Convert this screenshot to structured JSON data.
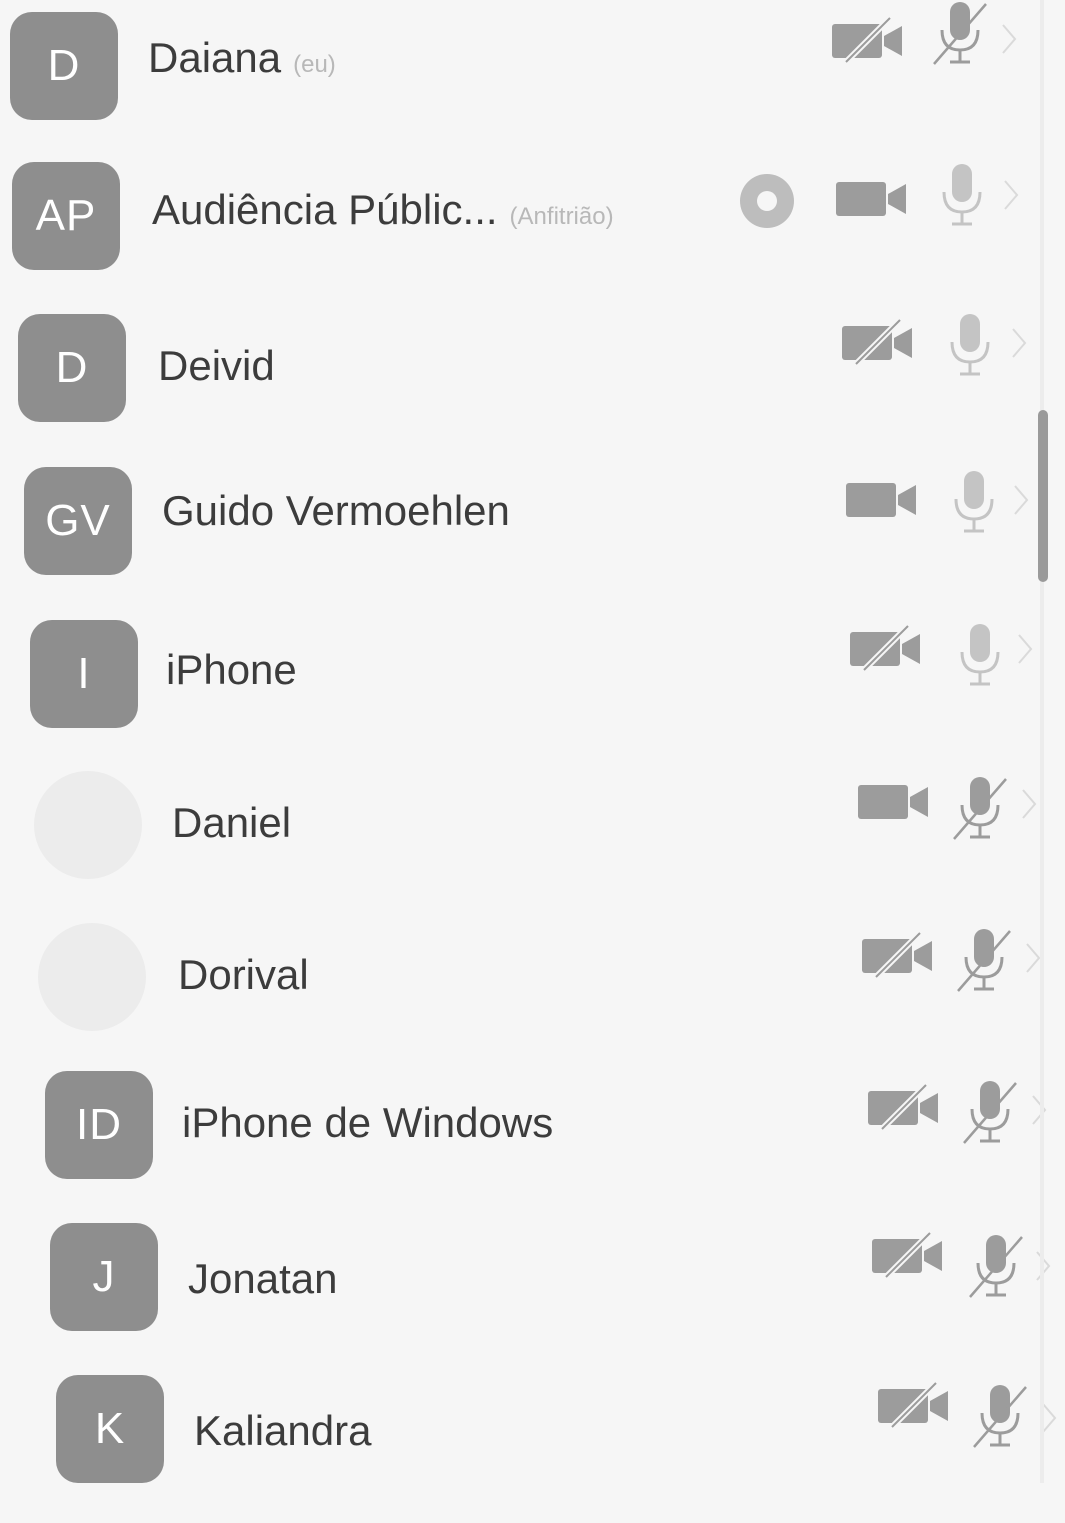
{
  "participants": [
    {
      "initials": "D",
      "name": "Daiana",
      "tag": "(eu)",
      "video_off": true,
      "mic_muted": true,
      "sharing": false,
      "faint_avatar": false
    },
    {
      "initials": "AP",
      "name": "Audiência Públic...",
      "tag": "(Anfitrião)",
      "video_off": false,
      "mic_muted": false,
      "sharing": true,
      "faint_avatar": false
    },
    {
      "initials": "D",
      "name": "Deivid",
      "tag": "",
      "video_off": true,
      "mic_muted": false,
      "sharing": false,
      "faint_avatar": false
    },
    {
      "initials": "GV",
      "name": "Guido Vermoehlen",
      "tag": "",
      "video_off": false,
      "mic_muted": false,
      "sharing": false,
      "faint_avatar": false
    },
    {
      "initials": "I",
      "name": "iPhone",
      "tag": "",
      "video_off": true,
      "mic_muted": false,
      "sharing": false,
      "faint_avatar": false
    },
    {
      "initials": "",
      "name": "Daniel",
      "tag": "",
      "video_off": false,
      "mic_muted": true,
      "sharing": false,
      "faint_avatar": true
    },
    {
      "initials": "",
      "name": "Dorival",
      "tag": "",
      "video_off": true,
      "mic_muted": true,
      "sharing": false,
      "faint_avatar": true
    },
    {
      "initials": "ID",
      "name": "iPhone de Windows",
      "tag": "",
      "video_off": true,
      "mic_muted": true,
      "sharing": false,
      "faint_avatar": false
    },
    {
      "initials": "J",
      "name": "Jonatan",
      "tag": "",
      "video_off": true,
      "mic_muted": true,
      "sharing": false,
      "faint_avatar": false
    },
    {
      "initials": "K",
      "name": "Kaliandra",
      "tag": "",
      "video_off": true,
      "mic_muted": true,
      "sharing": false,
      "faint_avatar": false
    }
  ],
  "icons": {
    "camera": "video-camera-icon",
    "mic": "microphone-icon",
    "share": "screen-share-icon",
    "chevron": "chevron-right-icon"
  },
  "colors": {
    "avatar": "#8e8e8e",
    "icon": "#9c9c9c",
    "icon_light": "#c4c4c4",
    "text": "#3c3c3c",
    "tag": "#b8b8b8"
  }
}
